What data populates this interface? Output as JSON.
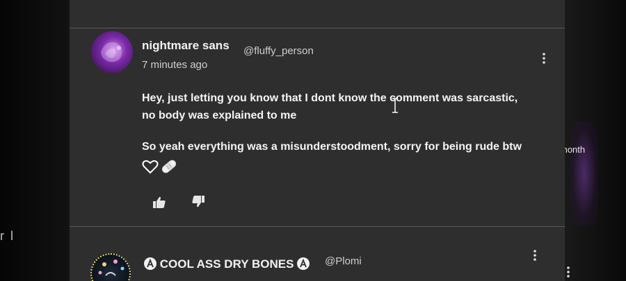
{
  "side": {
    "left_fragment": "r l",
    "right_fragment": "month"
  },
  "comments": [
    {
      "author": "nightmare sans",
      "handle": "@fluffy_person",
      "timestamp": "7 minutes ago",
      "body_lines": [
        "Hey, just letting you know that I dont know the comment was sarcastic,",
        "no body was explained to me",
        "So yeah everything was a misunderstoodment, sorry for being rude btw"
      ],
      "emojis": [
        "white-heart-icon",
        "bandage-icon"
      ],
      "actions": {
        "like": "thumbs-up-icon",
        "dislike": "thumbs-down-icon",
        "more": "more-vertical-icon"
      }
    },
    {
      "author": "COOL ASS DRY BONES",
      "handle": "@Plomi",
      "badges": [
        "anarchy-symbol-icon",
        "anarchy-symbol-icon"
      ],
      "actions": {
        "more": "more-vertical-icon"
      }
    }
  ],
  "colors": {
    "card_bg": "#2e2e2e",
    "text_primary": "#f5f5f5",
    "text_secondary": "#cfcfcf",
    "divider": "#5a5a5a",
    "avatar_purple": "#7a2aa8"
  }
}
